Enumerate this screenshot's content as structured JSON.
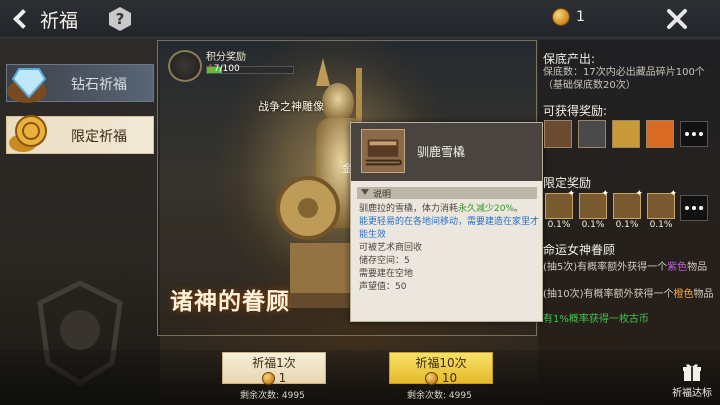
{
  "header": {
    "title": "祈福",
    "coin_count": "1"
  },
  "tabs": [
    {
      "label": "钻石祈福"
    },
    {
      "label": "限定祈福"
    }
  ],
  "banner": {
    "points_label": "积分奖励",
    "points_current": "1",
    "points_rest": "7/100",
    "points_progress": 0.17,
    "statue_name": "战争之神雕像",
    "partial_text": "金",
    "title": "诸神的眷顾"
  },
  "tooltip": {
    "item_name": "驯鹿雪橇",
    "section_label": "说明",
    "desc_prefix": "驯鹿拉的雪橇，体力消耗",
    "desc_highlight": "永久减少20%",
    "desc_suffix": "。",
    "move_note": "能更轻易的在各地间移动，需要建造在家里才能生效",
    "line_trade": "可被艺术商回收",
    "line_storage": "储存空间：5",
    "line_build": "需要建在空地",
    "line_fame": "声望值：50"
  },
  "guarantee": {
    "title": "保底产出:",
    "line1": "保底数：17次内必出藏品碎片100个",
    "line2": "（基础保底数20次）"
  },
  "rewards": {
    "title": "可获得奖励:",
    "items": [
      "sapphire-pendant",
      "iron-anvil",
      "golden-bars",
      "fire-relic",
      "wooden-box"
    ]
  },
  "limited": {
    "title": "限定奖励",
    "items": [
      {
        "icon": "sled-item",
        "pct": "0.1%"
      },
      {
        "icon": "treasure-item",
        "pct": "0.1%"
      },
      {
        "icon": "chariot-item",
        "pct": "0.1%"
      },
      {
        "icon": "statue-item",
        "pct": "0.1%"
      }
    ]
  },
  "goddess": {
    "title": "命运女神眷顾",
    "line1_prefix": "(抽5次)有概率额外获得一个",
    "line1_color": "紫色",
    "line1_suffix": "物品",
    "line2_prefix": "(抽10次)有概率额外获得一个",
    "line2_color": "橙色",
    "line2_suffix": "物品",
    "line3": "有1%概率获得一枚古币"
  },
  "actions": {
    "pray1_label": "祈福1次",
    "pray1_cost": "1",
    "pray1_remain": "剩余次数: 4995",
    "pray10_label": "祈福10次",
    "pray10_cost": "10",
    "pray10_remain": "剩余次数: 4995",
    "gift_label": "祈福达标"
  }
}
